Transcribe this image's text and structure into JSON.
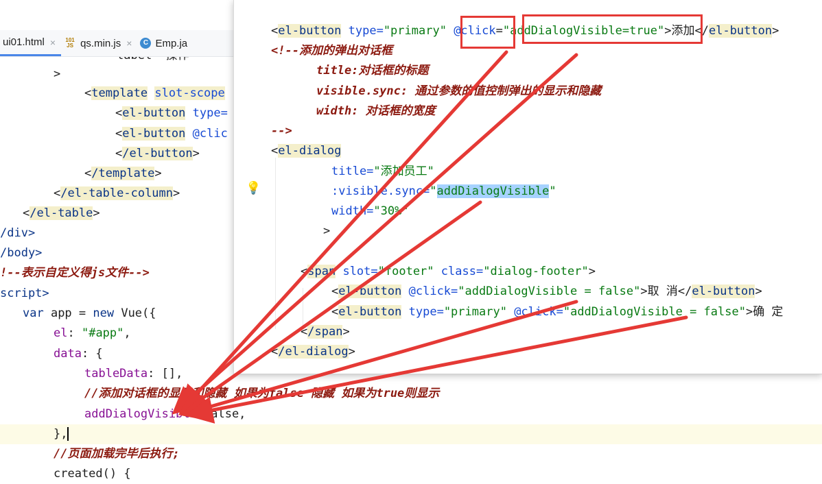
{
  "tabs": [
    {
      "name": "ui01.html",
      "icon": "html-file-icon",
      "active": true
    },
    {
      "name": "qs.min.js",
      "icon": "js-file-icon",
      "badge": "101\nJS"
    },
    {
      "name": "Emp.ja",
      "icon": "java-class-icon",
      "badge": "C"
    }
  ],
  "close_glyph": "×",
  "background_code": {
    "l0": "label=\"操作\"",
    "l1": ">",
    "l2_tag": "template",
    "l2_attr": "slot-scope",
    "l3_tag": "el-button",
    "l3_attr": "type=",
    "l4_tag": "el-button",
    "l4_attr": "@clic",
    "l5_tag": "/el-button",
    "l6_tag": "/template",
    "l7_tag": "/el-table-column",
    "l8_tag": "/el-table",
    "l9": "/div>",
    "l10": "/body>",
    "l11": "!--表示自定义得js文件-->",
    "l12": "script>",
    "l13_kw": "var",
    "l13_rest": " app = ",
    "l13_new": "new",
    "l13_end": " Vue({",
    "l14_prop": "el",
    "l14_str": "\"#app\"",
    "l15_prop": "data",
    "l15_rest": ": {",
    "l16_prop": "tableData",
    "l16_rest": ": [],",
    "l17": "//添加对话框的显示和隐藏 如果为false 隐藏 如果为true则显示",
    "l18_prop": "addDialogVisible",
    "l18_rest": ":false,",
    "l19": "},",
    "l20": "//页面加载完毕后执行;",
    "l21": "created() {"
  },
  "popup_code": {
    "p0_tag": "el-button",
    "p0_a1": "type=",
    "p0_s1": "\"primary\"",
    "p0_a2": "@click",
    "p0_eq": "=",
    "p0_s2": "\"addDialogVisible=true\"",
    "p0_text": ">添加</",
    "p0_tag2": "el-button",
    "p0_end": ">",
    "p1": "<!--添加的弹出对话框",
    "p2": "title:对话框的标题",
    "p3": "visible.sync: 通过参数的值控制弹出的显示和隐藏",
    "p4": "width: 对话框的宽度",
    "p5": "-->",
    "p6_tag": "el-dialog",
    "p7_a": "title=",
    "p7_s": "\"添加员工\"",
    "p8_a": ":visible.sync=",
    "p8_q": "\"",
    "p8_sel": "addDialogVisible",
    "p9_a": "width=",
    "p9_s": "\"30%\"",
    "p10": ">",
    "p11_tag": "span",
    "p11_a1": "slot=",
    "p11_s1": "\"footer\"",
    "p11_a2": "class=",
    "p11_s2": "\"dialog-footer\"",
    "p12_tag": "el-button",
    "p12_a": "@click=",
    "p12_s": "\"addDialogVisible = false\"",
    "p12_text": ">取 消</",
    "p12_tag2": "el-button",
    "p13_tag": "el-button",
    "p13_a1": "type=",
    "p13_s1": "\"primary\"",
    "p13_a2": "@click=",
    "p13_s2": "\"addDialogVisible = false\"",
    "p13_text": ">确 定",
    "p14_tag": "/span",
    "p15_tag": "/el-dialog"
  },
  "lightbulb_icon": "lightbulb-icon",
  "colors": {
    "arrow": "#e53935",
    "tag_bg": "#f4efcb",
    "selection": "#a6d2ff"
  }
}
